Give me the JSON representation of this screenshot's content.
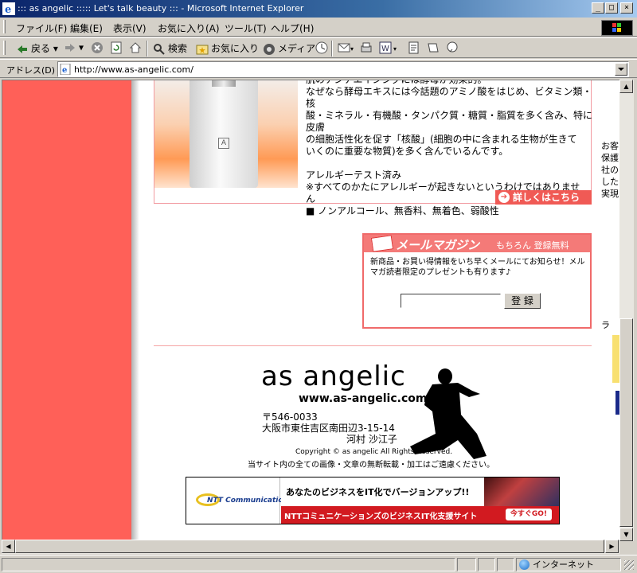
{
  "window": {
    "title": "::: as angelic ::::: Let's talk beauty ::: - Microsoft Internet Explorer",
    "minimize": "_",
    "maximize": "□",
    "close": "×"
  },
  "menubar": {
    "items": [
      "ファイル(F)",
      "編集(E)",
      "表示(V)",
      "お気に入り(A)",
      "ツール(T)",
      "ヘルプ(H)"
    ]
  },
  "toolbar": {
    "back_label": "戻る",
    "search_label": "検索",
    "favorites_label": "お気に入り",
    "media_label": "メディア"
  },
  "addressbar": {
    "label": "アドレス(D)",
    "url": "http://www.as-angelic.com/"
  },
  "product": {
    "lines": [
      "肌のアンチエイジングには酵母が効果的。",
      "なぜなら酵母エキスには今話題のアミノ酸をはじめ、ビタミン類・核",
      "酸・ミネラル・有機酸・タンパク質・糖質・脂質を多く含み、特に皮膚",
      "の細胞活性化を促す「核酸」(細胞の中に含まれる生物が生きて",
      "いくのに重要な物質)を多く含んでいるんです。",
      "",
      "アレルギーテスト済み",
      "※すべてのかたにアレルギーが起きないというわけではありませ",
      "ん",
      "■ ノンアルコール、無香料、無着色、弱酸性"
    ],
    "details_button": "詳しくはこちら",
    "bottle_mark": "A"
  },
  "right_clip": {
    "lines": [
      "",
      "",
      "",
      "",
      "",
      "お客",
      "保護",
      "社の",
      "した",
      "実現",
      "",
      "",
      "",
      "",
      "",
      "",
      "",
      "",
      "",
      "",
      "ラ"
    ]
  },
  "mail_magazine": {
    "title": "メールマガジン",
    "subtitle": "もちろん 登録無料",
    "description": "新商品・お買い得情報をいち早くメールにてお知らせ！メルマガ読者限定のプレゼントも有ります♪",
    "input_value": "",
    "submit_label": "登 録"
  },
  "footer": {
    "brand": "as angelic",
    "url": "www.as-angelic.com",
    "postal": "〒546-0033",
    "address": "大阪市東住吉区南田辺3-15-14",
    "person": "河村 沙江子",
    "copyright": "Copyright © as angelic All Rights Reserved.",
    "notice": "当サイト内の全ての画像・文章の無断転載・加工はご遠慮ください。"
  },
  "banner": {
    "logo_text": "NTT Communications",
    "headline": "あなたのビジネスをIT化でバージョンアップ!!",
    "subline": "NTTコミュニケーションズのビジネスIT化支援サイト",
    "cta": "今すぐGO!"
  },
  "statusbar": {
    "zone": "インターネット"
  },
  "colors": {
    "accent": "#f05a55",
    "left_panel": "#ff6058",
    "title_bar": "#0a246a"
  }
}
